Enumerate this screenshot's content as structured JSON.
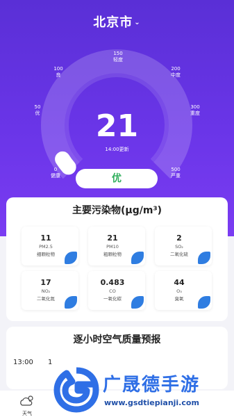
{
  "colors": {
    "accent": "#6a35e8",
    "good": "#2fae5b",
    "leaf": "#2f7de1",
    "brand": "#2f6fe6"
  },
  "header": {
    "city": "北京市",
    "dropdown_icon": "chevron-down-icon"
  },
  "gauge": {
    "aqi": "21",
    "updated": "14:00更新",
    "level": "优",
    "value": 21,
    "max": 500,
    "ticks": [
      {
        "value": "0",
        "label": "健康"
      },
      {
        "value": "50",
        "label": "优"
      },
      {
        "value": "100",
        "label": "良"
      },
      {
        "value": "150",
        "label": "轻度"
      },
      {
        "value": "200",
        "label": "中度"
      },
      {
        "value": "300",
        "label": "重度"
      },
      {
        "value": "500",
        "label": "严重"
      }
    ]
  },
  "pollutants": {
    "title": "主要污染物(μg/m³)",
    "items": [
      {
        "value": "11",
        "name": "PM2.5",
        "desc": "细颗粒物"
      },
      {
        "value": "21",
        "name": "PM10",
        "desc": "粗颗粒物"
      },
      {
        "value": "2",
        "name": "SO₂",
        "desc": "二氧化硫"
      },
      {
        "value": "17",
        "name": "NO₂",
        "desc": "二氧化氮"
      },
      {
        "value": "0.483",
        "name": "CO",
        "desc": "一氧化碳"
      },
      {
        "value": "44",
        "name": "O₃",
        "desc": "臭氧"
      }
    ]
  },
  "forecast": {
    "title": "逐小时空气质量预报",
    "hour": "13:00",
    "hour2": "1"
  },
  "tabbar": {
    "weather_label": "天气",
    "weather_icon": "cloud-sun-icon"
  },
  "watermark": {
    "name": "广晟德手游",
    "url": "www.gsdtiepianji.com"
  }
}
